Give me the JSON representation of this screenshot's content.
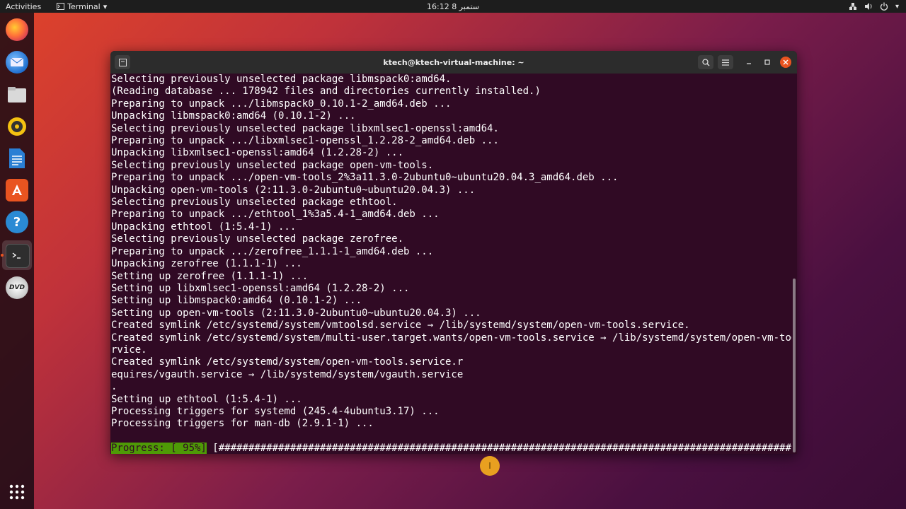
{
  "topbar": {
    "activities": "Activities",
    "app_name": "Terminal",
    "clock": "16:12  8 ستمبر",
    "tray_icons": [
      "network-icon",
      "volume-icon",
      "power-icon"
    ]
  },
  "dock": {
    "items": [
      "firefox-icon",
      "thunderbird-icon",
      "files-icon",
      "rhythmbox-icon",
      "writer-icon",
      "software-icon",
      "help-icon",
      "terminal-icon",
      "dvd-icon"
    ],
    "apps_grid": "show-applications-icon",
    "dvd_label": "DVD"
  },
  "window": {
    "title": "ktech@ktech-virtual-machine: ~",
    "colors": {
      "background": "#300a24",
      "progress": "#4e9a06"
    }
  },
  "terminal": {
    "lines": [
      "Selecting previously unselected package libmspack0:amd64.",
      "(Reading database ... 178942 files and directories currently installed.)",
      "Preparing to unpack .../libmspack0_0.10.1-2_amd64.deb ...",
      "Unpacking libmspack0:amd64 (0.10.1-2) ...",
      "Selecting previously unselected package libxmlsec1-openssl:amd64.",
      "Preparing to unpack .../libxmlsec1-openssl_1.2.28-2_amd64.deb ...",
      "Unpacking libxmlsec1-openssl:amd64 (1.2.28-2) ...",
      "Selecting previously unselected package open-vm-tools.",
      "Preparing to unpack .../open-vm-tools_2%3a11.3.0-2ubuntu0~ubuntu20.04.3_amd64.deb ...",
      "Unpacking open-vm-tools (2:11.3.0-2ubuntu0~ubuntu20.04.3) ...",
      "Selecting previously unselected package ethtool.",
      "Preparing to unpack .../ethtool_1%3a5.4-1_amd64.deb ...",
      "Unpacking ethtool (1:5.4-1) ...",
      "Selecting previously unselected package zerofree.",
      "Preparing to unpack .../zerofree_1.1.1-1_amd64.deb ...",
      "Unpacking zerofree (1.1.1-1) ...",
      "Setting up zerofree (1.1.1-1) ...",
      "Setting up libxmlsec1-openssl:amd64 (1.2.28-2) ...",
      "Setting up libmspack0:amd64 (0.10.1-2) ...",
      "Setting up open-vm-tools (2:11.3.0-2ubuntu0~ubuntu20.04.3) ...",
      "Created symlink /etc/systemd/system/vmtoolsd.service → /lib/systemd/system/open-vm-tools.service.",
      "Created symlink /etc/systemd/system/multi-user.target.wants/open-vm-tools.service → /lib/systemd/system/open-vm-tools.se",
      "rvice.",
      "Created symlink /etc/systemd/system/open-vm-tools.service.r",
      "equires/vgauth.service → /lib/systemd/system/vgauth.service",
      ".",
      "Setting up ethtool (1:5.4-1) ...",
      "Processing triggers for systemd (245.4-4ubuntu3.17) ...",
      "Processing triggers for man-db (2.9.1-1) ...",
      ""
    ],
    "progress_label": "Progress: [ 95%]",
    "progress_bar": " [################################################################################################.....]",
    "progress_percent": 95
  }
}
